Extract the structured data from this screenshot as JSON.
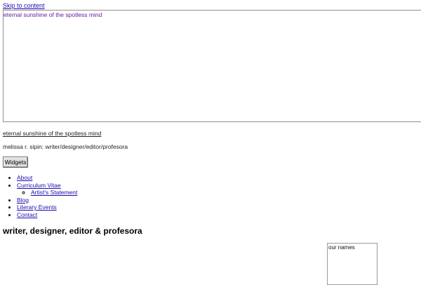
{
  "skip_link": "Skip to content",
  "header": {
    "image_alt": "eternal sunshine of the spotless mind",
    "site_title": "eternal sunshine of the spotless mind",
    "tagline": "melissa r. sipin: writer/designer/editor/profesora"
  },
  "widgets_button": "Widgets",
  "nav": {
    "items": [
      {
        "label": "About"
      },
      {
        "label": "Curriculum Vitae",
        "children": [
          {
            "label": "Artist's Statement"
          }
        ]
      },
      {
        "label": "Blog"
      },
      {
        "label": "Literary Events"
      },
      {
        "label": "Contact"
      }
    ]
  },
  "content": {
    "title": "writer, designer, editor & profesora"
  },
  "sidebar": {
    "box_label": "our names"
  },
  "colors": {
    "link": "#1a0dab",
    "alt_text": "#6a1b9a",
    "border": "#8f8f8f",
    "button_bg": "#e0e0e0"
  }
}
